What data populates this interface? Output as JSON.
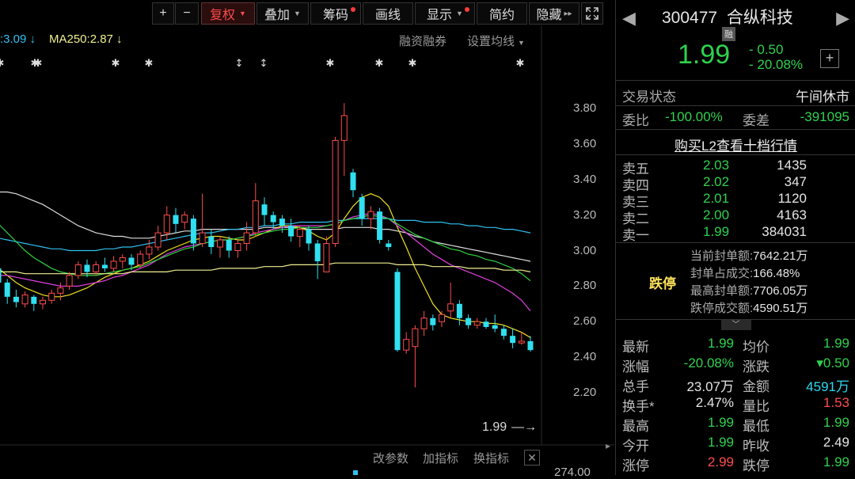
{
  "toolbar": {
    "plus": "+",
    "minus": "−",
    "fuquan": "复权",
    "diejia": "叠加",
    "chouma": "筹码",
    "huaxian": "画线",
    "xianshi": "显示",
    "jianyue": "简约",
    "yincang": "隐藏"
  },
  "legend": {
    "ma_prev": ":3.09",
    "ma250": "MA250:2.87"
  },
  "links": {
    "rongzi": "融资融券",
    "set_ma": "设置均线",
    "gaicanshu": "改参数",
    "jiazhibiao": "加指标",
    "huanzhibiao": "换指标",
    "price_tag": "1.99",
    "vol_partial": "274.00"
  },
  "yaxis": [
    "3.80",
    "3.60",
    "3.40",
    "3.20",
    "3.00",
    "2.80",
    "2.60",
    "2.40",
    "2.20"
  ],
  "chart_data": {
    "type": "candlestick",
    "ylim": [
      2.2,
      3.9
    ],
    "candles": [
      [
        2.9,
        2.82,
        2.94,
        2.78
      ],
      [
        2.82,
        2.74,
        2.84,
        2.7
      ],
      [
        2.74,
        2.71,
        2.78,
        2.68
      ],
      [
        2.7,
        2.75,
        2.77,
        2.68
      ],
      [
        2.74,
        2.7,
        2.75,
        2.66
      ],
      [
        2.7,
        2.72,
        2.74,
        2.67
      ],
      [
        2.72,
        2.76,
        2.78,
        2.7
      ],
      [
        2.76,
        2.79,
        2.82,
        2.72
      ],
      [
        2.8,
        2.86,
        2.88,
        2.78
      ],
      [
        2.86,
        2.92,
        2.94,
        2.84
      ],
      [
        2.92,
        2.88,
        2.95,
        2.85
      ],
      [
        2.88,
        2.92,
        2.94,
        2.86
      ],
      [
        2.92,
        2.9,
        2.96,
        2.88
      ],
      [
        2.9,
        2.94,
        2.97,
        2.88
      ],
      [
        2.94,
        2.96,
        2.98,
        2.9
      ],
      [
        2.96,
        2.92,
        2.98,
        2.89
      ],
      [
        2.92,
        2.98,
        3.0,
        2.9
      ],
      [
        2.98,
        3.02,
        3.06,
        2.95
      ],
      [
        3.02,
        3.1,
        3.14,
        3.0
      ],
      [
        3.1,
        3.2,
        3.25,
        3.06
      ],
      [
        3.2,
        3.15,
        3.24,
        3.1
      ],
      [
        3.16,
        3.2,
        3.22,
        3.12
      ],
      [
        3.18,
        3.04,
        3.2,
        3.0
      ],
      [
        3.04,
        3.1,
        3.32,
        3.02
      ],
      [
        3.08,
        3.02,
        3.12,
        2.98
      ],
      [
        3.02,
        3.06,
        3.08,
        2.96
      ],
      [
        3.06,
        3.0,
        3.08,
        2.96
      ],
      [
        3.0,
        3.04,
        3.06,
        2.96
      ],
      [
        3.04,
        3.1,
        3.16,
        3.0
      ],
      [
        3.1,
        3.28,
        3.38,
        3.08
      ],
      [
        3.26,
        3.2,
        3.3,
        3.14
      ],
      [
        3.2,
        3.16,
        3.22,
        3.12
      ],
      [
        3.18,
        3.14,
        3.2,
        3.1
      ],
      [
        3.14,
        3.08,
        3.18,
        3.05
      ],
      [
        3.08,
        3.12,
        3.14,
        3.02
      ],
      [
        3.12,
        3.04,
        3.14,
        3.0
      ],
      [
        3.04,
        2.94,
        3.06,
        2.84
      ],
      [
        2.88,
        3.04,
        3.08,
        2.88
      ],
      [
        3.04,
        3.62,
        3.64,
        3.02
      ],
      [
        3.62,
        3.76,
        3.83,
        3.42
      ],
      [
        3.44,
        3.34,
        3.46,
        3.3
      ],
      [
        3.3,
        3.18,
        3.32,
        3.14
      ],
      [
        3.18,
        3.22,
        3.25,
        3.12
      ],
      [
        3.22,
        3.06,
        3.24,
        3.04
      ],
      [
        3.04,
        3.02,
        3.06,
        3.0
      ],
      [
        2.88,
        2.44,
        2.9,
        2.43
      ],
      [
        2.44,
        2.5,
        2.54,
        2.42
      ],
      [
        2.46,
        2.56,
        2.58,
        2.23
      ],
      [
        2.56,
        2.62,
        2.66,
        2.52
      ],
      [
        2.62,
        2.58,
        2.64,
        2.55
      ],
      [
        2.6,
        2.64,
        2.66,
        2.57
      ],
      [
        2.66,
        2.7,
        2.82,
        2.62
      ],
      [
        2.7,
        2.62,
        2.72,
        2.58
      ],
      [
        2.62,
        2.58,
        2.64,
        2.56
      ],
      [
        2.58,
        2.6,
        2.62,
        2.56
      ],
      [
        2.6,
        2.57,
        2.62,
        2.56
      ],
      [
        2.58,
        2.56,
        2.64,
        2.54
      ],
      [
        2.56,
        2.52,
        2.58,
        2.5
      ],
      [
        2.52,
        2.48,
        2.56,
        2.45
      ],
      [
        2.48,
        2.49,
        2.54,
        2.47
      ],
      [
        2.49,
        2.44,
        2.52,
        2.43
      ]
    ],
    "ma_lines": [
      {
        "color": "#dddddd",
        "points": [
          3.33,
          3.33,
          3.32,
          3.3,
          3.28,
          3.26,
          3.23,
          3.2,
          3.17,
          3.14,
          3.12,
          3.1,
          3.09,
          3.08,
          3.08,
          3.07,
          3.07,
          3.07,
          3.08,
          3.09,
          3.1,
          3.11,
          3.11,
          3.12,
          3.12,
          3.12,
          3.12,
          3.12,
          3.12,
          3.12,
          3.13,
          3.13,
          3.13,
          3.13,
          3.13,
          3.12,
          3.12,
          3.12,
          3.12,
          3.13,
          3.13,
          3.13,
          3.13,
          3.12,
          3.12,
          3.11,
          3.1,
          3.08,
          3.07,
          3.05,
          3.04,
          3.03,
          3.02,
          3.01,
          3.0,
          2.99,
          2.98,
          2.97,
          2.96,
          2.95,
          2.94
        ]
      },
      {
        "color": "#f0e020",
        "points": [
          2.9,
          2.86,
          2.82,
          2.79,
          2.77,
          2.75,
          2.74,
          2.74,
          2.75,
          2.77,
          2.79,
          2.82,
          2.85,
          2.87,
          2.89,
          2.9,
          2.92,
          2.94,
          2.97,
          3.0,
          3.02,
          3.04,
          3.06,
          3.07,
          3.08,
          3.08,
          3.07,
          3.06,
          3.06,
          3.08,
          3.1,
          3.12,
          3.14,
          3.14,
          3.13,
          3.11,
          3.08,
          3.06,
          3.1,
          3.18,
          3.25,
          3.3,
          3.32,
          3.3,
          3.25,
          3.13,
          3.02,
          2.9,
          2.8,
          2.7,
          2.64,
          2.62,
          2.61,
          2.6,
          2.6,
          2.59,
          2.59,
          2.58,
          2.56,
          2.54,
          2.51
        ]
      },
      {
        "color": "#e040e0",
        "points": [
          2.86,
          2.86,
          2.85,
          2.84,
          2.83,
          2.82,
          2.81,
          2.8,
          2.8,
          2.8,
          2.81,
          2.82,
          2.83,
          2.85,
          2.86,
          2.88,
          2.9,
          2.92,
          2.95,
          2.98,
          3.0,
          3.02,
          3.03,
          3.04,
          3.05,
          3.06,
          3.06,
          3.07,
          3.08,
          3.1,
          3.11,
          3.12,
          3.13,
          3.14,
          3.14,
          3.14,
          3.14,
          3.14,
          3.15,
          3.17,
          3.19,
          3.2,
          3.21,
          3.2,
          3.18,
          3.14,
          3.1,
          3.06,
          3.02,
          2.98,
          2.95,
          2.92,
          2.9,
          2.88,
          2.86,
          2.84,
          2.82,
          2.79,
          2.76,
          2.72,
          2.66
        ]
      },
      {
        "color": "#30c0f0",
        "points": [
          3.07,
          3.06,
          3.05,
          3.04,
          3.03,
          3.02,
          3.01,
          3.01,
          3.0,
          3.0,
          3.0,
          3.0,
          3.01,
          3.01,
          3.02,
          3.02,
          3.03,
          3.04,
          3.05,
          3.06,
          3.07,
          3.08,
          3.09,
          3.1,
          3.1,
          3.11,
          3.12,
          3.12,
          3.13,
          3.13,
          3.14,
          3.14,
          3.15,
          3.15,
          3.16,
          3.16,
          3.16,
          3.16,
          3.17,
          3.17,
          3.18,
          3.18,
          3.18,
          3.18,
          3.18,
          3.17,
          3.17,
          3.17,
          3.16,
          3.16,
          3.16,
          3.15,
          3.15,
          3.14,
          3.14,
          3.13,
          3.13,
          3.12,
          3.12,
          3.11,
          3.1
        ]
      },
      {
        "color": "#30d040",
        "points": [
          3.15,
          3.1,
          3.05,
          3.0,
          2.96,
          2.93,
          2.9,
          2.88,
          2.87,
          2.86,
          2.86,
          2.86,
          2.87,
          2.88,
          2.89,
          2.9,
          2.91,
          2.93,
          2.95,
          2.97,
          2.99,
          3.01,
          3.02,
          3.04,
          3.05,
          3.06,
          3.06,
          3.07,
          3.08,
          3.09,
          3.1,
          3.11,
          3.12,
          3.12,
          3.13,
          3.13,
          3.13,
          3.14,
          3.15,
          3.17,
          3.18,
          3.19,
          3.2,
          3.19,
          3.18,
          3.15,
          3.12,
          3.09,
          3.07,
          3.05,
          3.03,
          3.01,
          3.0,
          2.98,
          2.97,
          2.95,
          2.94,
          2.92,
          2.9,
          2.87,
          2.83
        ]
      },
      {
        "color": "#f0f090",
        "points": [
          2.88,
          2.88,
          2.88,
          2.87,
          2.87,
          2.87,
          2.87,
          2.87,
          2.87,
          2.87,
          2.87,
          2.87,
          2.87,
          2.87,
          2.87,
          2.88,
          2.88,
          2.88,
          2.88,
          2.88,
          2.89,
          2.89,
          2.89,
          2.89,
          2.89,
          2.9,
          2.9,
          2.9,
          2.9,
          2.9,
          2.91,
          2.91,
          2.91,
          2.92,
          2.92,
          2.92,
          2.92,
          2.92,
          2.93,
          2.93,
          2.93,
          2.93,
          2.93,
          2.93,
          2.93,
          2.92,
          2.92,
          2.92,
          2.92,
          2.91,
          2.91,
          2.91,
          2.91,
          2.9,
          2.9,
          2.9,
          2.9,
          2.89,
          2.89,
          2.89,
          2.88
        ]
      }
    ]
  },
  "quote": {
    "code": "300477",
    "name": "合纵科技",
    "rong": "融",
    "price": "1.99",
    "change": "- 0.50",
    "pct": "- 20.08%"
  },
  "status": {
    "lbl": "交易状态",
    "val": "午间休市",
    "weibi_lbl": "委比",
    "weibi": "-100.00%",
    "weicha_lbl": "委差",
    "weicha": "-391095",
    "l2": "购买L2查看十档行情"
  },
  "asks": [
    {
      "label": "卖五",
      "price": "2.03",
      "vol": "1435"
    },
    {
      "label": "卖四",
      "price": "2.02",
      "vol": "347"
    },
    {
      "label": "卖三",
      "price": "2.01",
      "vol": "1120"
    },
    {
      "label": "卖二",
      "price": "2.00",
      "vol": "4163"
    },
    {
      "label": "卖一",
      "price": "1.99",
      "vol": "384031"
    }
  ],
  "seal": {
    "badge": "跌停",
    "r1_lbl": "当前封单额:",
    "r1": "7642.21万",
    "r2_lbl": "封单占成交:",
    "r2": "166.48%",
    "r3_lbl": "最高封单额:",
    "r3": "7706.05万",
    "r4_lbl": "跌停成交额:",
    "r4": "4590.51万"
  },
  "stats": [
    {
      "l1": "最新",
      "v1": "1.99",
      "l2": "均价",
      "v2": "1.99",
      "c1": "green",
      "c2": "green"
    },
    {
      "l1": "涨幅",
      "v1": "-20.08%",
      "l2": "涨跌",
      "v2": "▾0.50",
      "c1": "green",
      "c2": "green"
    },
    {
      "l1": "总手",
      "v1": "23.07万",
      "l2": "金额",
      "v2": "4591万",
      "c1": "white",
      "c2": "cyan"
    },
    {
      "l1": "换手*",
      "v1": "2.47%",
      "l2": "量比",
      "v2": "1.53",
      "c1": "white",
      "c2": "red"
    },
    {
      "l1": "最高",
      "v1": "1.99",
      "l2": "最低",
      "v2": "1.99",
      "c1": "green",
      "c2": "green"
    },
    {
      "l1": "今开",
      "v1": "1.99",
      "l2": "昨收",
      "v2": "2.49",
      "c1": "green",
      "c2": "white"
    },
    {
      "l1": "涨停",
      "v1": "2.99",
      "l2": "跌停",
      "v2": "1.99",
      "c1": "red",
      "c2": "green"
    }
  ]
}
